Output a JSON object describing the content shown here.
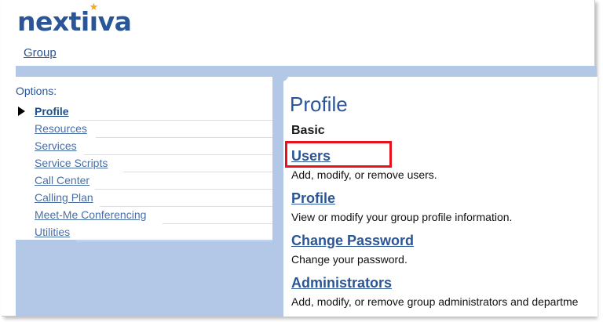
{
  "brand": {
    "logo_text_pre": "nexti",
    "logo_text_i": "ı",
    "logo_text_post": "va",
    "star": "★"
  },
  "header": {
    "group_link": "Group"
  },
  "sidebar": {
    "options_label": "Options:",
    "items": [
      {
        "label": "Profile",
        "active": true
      },
      {
        "label": "Resources"
      },
      {
        "label": "Services"
      },
      {
        "label": "Service Scripts"
      },
      {
        "label": "Call Center"
      },
      {
        "label": "Calling Plan"
      },
      {
        "label": "Meet-Me Conferencing"
      },
      {
        "label": "Utilities"
      }
    ]
  },
  "main": {
    "title": "Profile",
    "section": "Basic",
    "entries": [
      {
        "link": "Users",
        "desc": "Add, modify, or remove users."
      },
      {
        "link": "Profile",
        "desc": "View or modify your group profile information."
      },
      {
        "link": "Change Password",
        "desc": "Change your password."
      },
      {
        "link": "Administrators",
        "desc": "Add, modify, or remove group administrators and departme"
      }
    ]
  },
  "colors": {
    "brand_blue": "#2a5597",
    "band": "#b3c8e6",
    "highlight": "#e8121f",
    "star": "#f5a623"
  }
}
